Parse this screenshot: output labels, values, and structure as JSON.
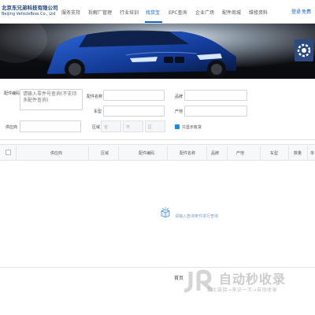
{
  "header": {
    "company_name": "北京东兄弟科技有限公司",
    "company_name_en": "Beijing VehicleBros Co., Ltd",
    "nav": [
      "服务支持",
      "拆解厂管理",
      "行业培训",
      "找货宝",
      "EPC查询",
      "企业广场",
      "配件商城",
      "维修资料"
    ],
    "active_nav": "找货宝",
    "login": "登录",
    "register": "免费"
  },
  "search": {
    "part_code_label": "配件编码",
    "part_code_placeholder": "请输入零件号查询(不支持多配件查询)",
    "part_name_label": "配件名称",
    "brand_label": "品牌",
    "model_label": "车型",
    "origin_label": "产地",
    "supplier_label": "供应商",
    "region_label": "区域",
    "region_province": "省",
    "region_city": "市",
    "region_district": "区",
    "only_in_stock_label": "只显示有货",
    "only_in_stock_checked": true
  },
  "table": {
    "columns": [
      "供应商",
      "区域",
      "配件编码",
      "配件名称",
      "品牌",
      "产地",
      "车型",
      "数量",
      "单"
    ],
    "empty_text": "请输入查询条件进行查询"
  },
  "footer": {
    "left_text": "首页"
  },
  "watermark": {
    "title": "自动秒收录",
    "subtitle": "数上链接→来访一次→自动收录"
  },
  "colors": {
    "accent": "#1565c0",
    "checkbox": "#1e88e5",
    "fab": "#2c4a7d"
  }
}
